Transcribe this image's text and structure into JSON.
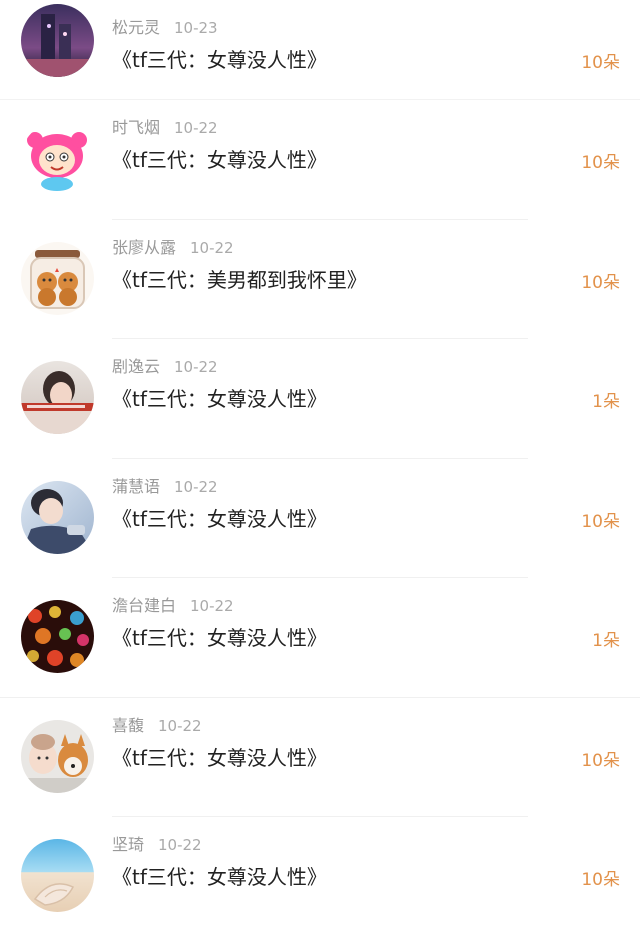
{
  "colors": {
    "gift_text": "#e2924b",
    "name_text": "#999999",
    "title_text": "#222222"
  },
  "entries": [
    {
      "name": "松元灵",
      "date": "10-23",
      "book": "《tf三代：女尊没人性》",
      "gift": "10朵",
      "avatar": "night-city-avatar"
    },
    {
      "name": "时飞烟",
      "date": "10-22",
      "book": "《tf三代：女尊没人性》",
      "gift": "10朵",
      "avatar": "pink-cartoon-avatar"
    },
    {
      "name": "张廖从露",
      "date": "10-22",
      "book": "《tf三代：美男都到我怀里》",
      "gift": "10朵",
      "avatar": "bear-jar-avatar"
    },
    {
      "name": "剧逸云",
      "date": "10-22",
      "book": "《tf三代：女尊没人性》",
      "gift": "1朵",
      "avatar": "portrait-photo-avatar"
    },
    {
      "name": "蒲慧语",
      "date": "10-22",
      "book": "《tf三代：女尊没人性》",
      "gift": "10朵",
      "avatar": "boy-photo-avatar"
    },
    {
      "name": "澹台建白",
      "date": "10-22",
      "book": "《tf三代：女尊没人性》",
      "gift": "1朵",
      "avatar": "bokeh-lights-avatar"
    },
    {
      "name": "喜馥",
      "date": "10-22",
      "book": "《tf三代：女尊没人性》",
      "gift": "10朵",
      "avatar": "girl-dog-avatar"
    },
    {
      "name": "坚琦",
      "date": "10-22",
      "book": "《tf三代：女尊没人性》",
      "gift": "10朵",
      "avatar": "beach-avatar"
    }
  ]
}
